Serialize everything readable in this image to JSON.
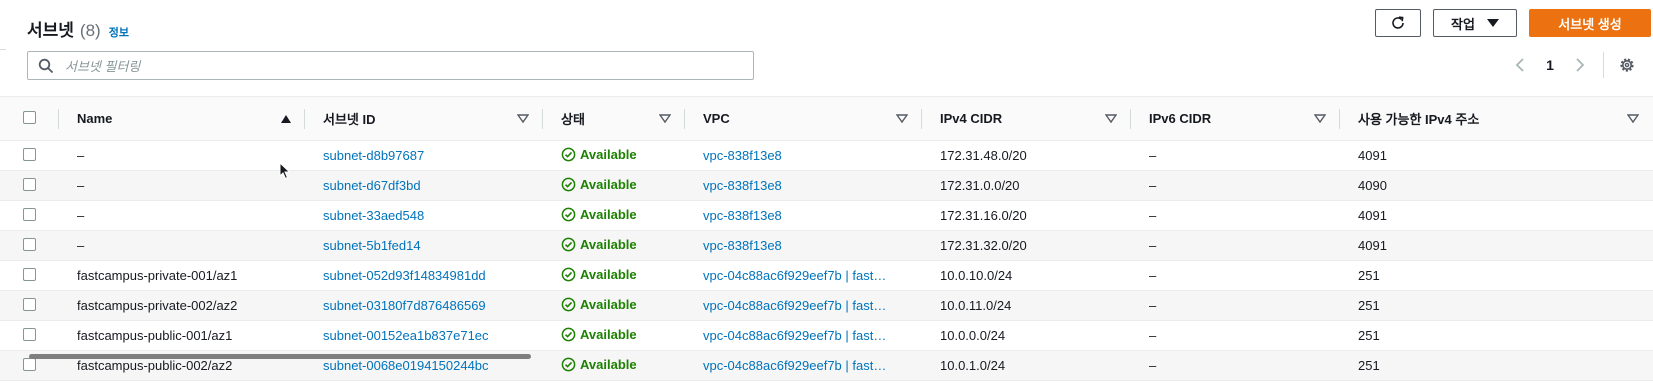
{
  "header": {
    "title": "서브넷",
    "count": "(8)",
    "info_link": "정보",
    "actions_label": "작업",
    "create_label": "서브넷 생성"
  },
  "search": {
    "placeholder": "서브넷 필터링",
    "value": ""
  },
  "pagination": {
    "current_page": "1"
  },
  "table": {
    "columns": [
      "Name",
      "서브넷 ID",
      "상태",
      "VPC",
      "IPv4 CIDR",
      "IPv6 CIDR",
      "사용 가능한 IPv4 주소"
    ],
    "rows": [
      {
        "name": "–",
        "subnet_id": "subnet-d8b97687",
        "status": "Available",
        "vpc": "vpc-838f13e8",
        "ipv4_cidr": "172.31.48.0/20",
        "ipv6_cidr": "–",
        "available_ipv4": "4091"
      },
      {
        "name": "–",
        "subnet_id": "subnet-d67df3bd",
        "status": "Available",
        "vpc": "vpc-838f13e8",
        "ipv4_cidr": "172.31.0.0/20",
        "ipv6_cidr": "–",
        "available_ipv4": "4090"
      },
      {
        "name": "–",
        "subnet_id": "subnet-33aed548",
        "status": "Available",
        "vpc": "vpc-838f13e8",
        "ipv4_cidr": "172.31.16.0/20",
        "ipv6_cidr": "–",
        "available_ipv4": "4091"
      },
      {
        "name": "–",
        "subnet_id": "subnet-5b1fed14",
        "status": "Available",
        "vpc": "vpc-838f13e8",
        "ipv4_cidr": "172.31.32.0/20",
        "ipv6_cidr": "–",
        "available_ipv4": "4091"
      },
      {
        "name": "fastcampus-private-001/az1",
        "subnet_id": "subnet-052d93f14834981dd",
        "status": "Available",
        "vpc": "vpc-04c88ac6f929eef7b | fast…",
        "ipv4_cidr": "10.0.10.0/24",
        "ipv6_cidr": "–",
        "available_ipv4": "251"
      },
      {
        "name": "fastcampus-private-002/az2",
        "subnet_id": "subnet-03180f7d876486569",
        "status": "Available",
        "vpc": "vpc-04c88ac6f929eef7b | fast…",
        "ipv4_cidr": "10.0.11.0/24",
        "ipv6_cidr": "–",
        "available_ipv4": "251"
      },
      {
        "name": "fastcampus-public-001/az1",
        "subnet_id": "subnet-00152ea1b837e71ec",
        "status": "Available",
        "vpc": "vpc-04c88ac6f929eef7b | fast…",
        "ipv4_cidr": "10.0.0.0/24",
        "ipv6_cidr": "–",
        "available_ipv4": "251"
      },
      {
        "name": "fastcampus-public-002/az2",
        "subnet_id": "subnet-0068e0194150244bc",
        "status": "Available",
        "vpc": "vpc-04c88ac6f929eef7b | fast…",
        "ipv4_cidr": "10.0.1.0/24",
        "ipv6_cidr": "–",
        "available_ipv4": "251"
      }
    ]
  },
  "colors": {
    "primary_button": "#ec7211",
    "link": "#0073bb",
    "status_available": "#1d8102"
  },
  "icons": {
    "refresh": "refresh-icon",
    "dropdown": "caret-down-icon",
    "search": "search-icon",
    "prev": "chevron-left-icon",
    "next": "chevron-right-icon",
    "settings": "gear-icon",
    "status": "check-circle-icon",
    "sort": "sort-ascending-icon",
    "filter": "filter-caret-icon"
  }
}
